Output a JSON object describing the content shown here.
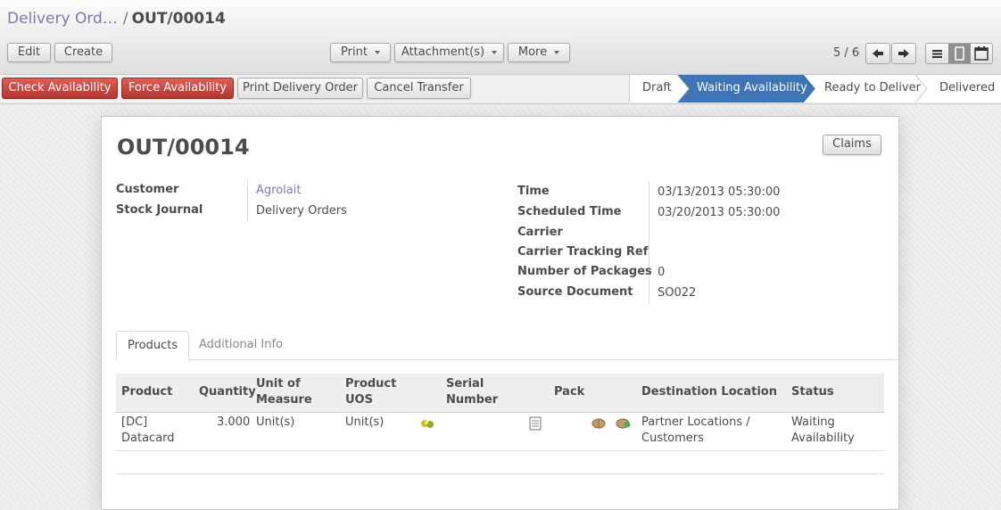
{
  "breadcrumb": {
    "parent": "Delivery Ord…",
    "separator": "/",
    "current": "OUT/00014"
  },
  "toolbar": {
    "edit": "Edit",
    "create": "Create",
    "print": "Print",
    "attachments": "Attachment(s)",
    "more": "More"
  },
  "pager": {
    "text": "5 / 6"
  },
  "actions": {
    "check_availability": "Check Availability",
    "force_availability": "Force Availability",
    "print_delivery_order": "Print Delivery Order",
    "cancel_transfer": "Cancel Transfer"
  },
  "stages": [
    "Draft",
    "Waiting Availability",
    "Ready to Deliver",
    "Delivered"
  ],
  "record": {
    "title": "OUT/00014",
    "claims_button": "Claims",
    "left": [
      {
        "label": "Customer",
        "value": "Agrolait"
      },
      {
        "label": "Stock Journal",
        "value": "Delivery Orders"
      }
    ],
    "right": [
      {
        "label": "Time",
        "value": "03/13/2013 05:30:00"
      },
      {
        "label": "Scheduled Time",
        "value": "03/20/2013 05:30:00"
      },
      {
        "label": "Carrier",
        "value": ""
      },
      {
        "label": "Carrier Tracking Ref",
        "value": ""
      },
      {
        "label": "Number of Packages",
        "value": "0"
      },
      {
        "label": "Source Document",
        "value": "SO022"
      }
    ]
  },
  "tabs": [
    "Products",
    "Additional Info"
  ],
  "lines": {
    "headers": {
      "product": "Product",
      "quantity": "Quantity",
      "uom_1": "Unit of",
      "uom_2": "Measure",
      "uos_1": "Product",
      "uos_2": "UOS",
      "serial_1": "Serial",
      "serial_2": "Number",
      "pack": "Pack",
      "destination": "Destination Location",
      "status": "Status"
    },
    "rows": [
      {
        "product_1": "[DC]",
        "product_2": "Datacard",
        "quantity": "3.000",
        "uom": "Unit(s)",
        "uos": "Unit(s)",
        "dest_1": "Partner Locations /",
        "dest_2": "Customers",
        "status_1": "Waiting",
        "status_2": "Availability"
      }
    ]
  },
  "colors": {
    "link": "#7c7bad",
    "active_stage": "#3f74b5",
    "danger": "#c0392b"
  }
}
